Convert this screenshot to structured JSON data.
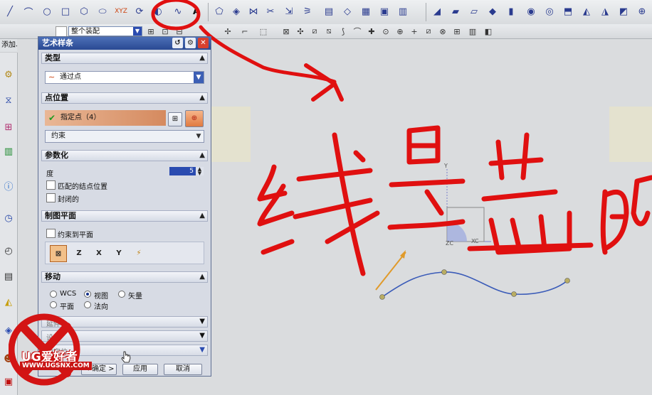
{
  "toolbar": {
    "assembly_combo": "整个装配",
    "tab_strip": "添加、插入"
  },
  "dialog": {
    "title": "艺术样条",
    "type_section": {
      "header": "类型",
      "value": "通过点"
    },
    "point_section": {
      "header": "点位置",
      "specify_label": "指定点（4）",
      "constraint_value": "约束"
    },
    "param_section": {
      "header": "参数化",
      "degree_label": "度",
      "degree_value": "5",
      "match_knots": "匹配的结点位置",
      "closed": "封闭的"
    },
    "plane_section": {
      "header": "制图平面",
      "constrain_to_plane": "约束到平面"
    },
    "move_section": {
      "header": "移动",
      "radio_wcs": "WCS",
      "radio_view": "视图",
      "radio_vector": "矢量",
      "radio_plane": "平面",
      "radio_normal": "法向"
    },
    "collapsed_rows": [
      "延伸",
      "设置",
      "微定位"
    ],
    "buttons": {
      "ok": "< 确定 >",
      "apply": "应用",
      "cancel": "取消"
    }
  },
  "canvas": {
    "axis_y": "Y",
    "axis_xc": "XC",
    "axis_zc": "ZC",
    "annotation_handwriting": "线是蓝的"
  },
  "watermark": {
    "brand": "UG爱好者",
    "url": "WWW.UGSNX.COM"
  },
  "colors": {
    "spline": "#3a5bb8",
    "annotation": "#e01010",
    "dialog_title": "#2a4a93"
  }
}
